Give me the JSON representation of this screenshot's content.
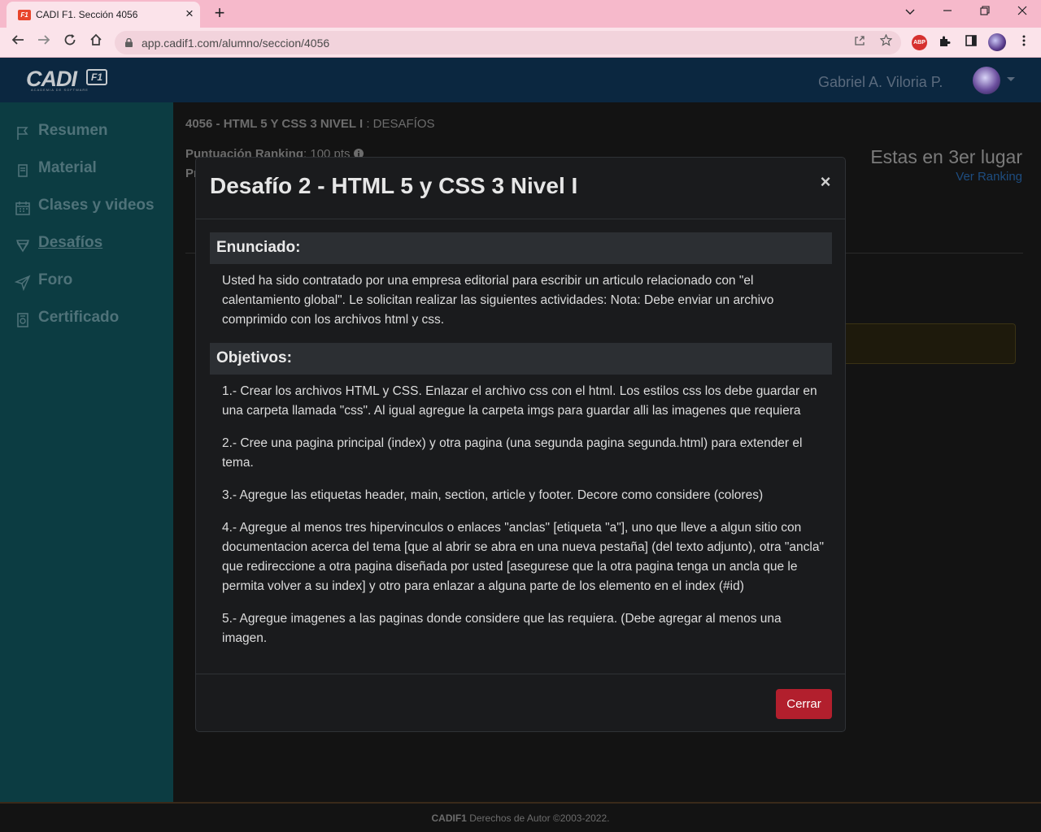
{
  "browser": {
    "tab_title": "CADI F1. Sección 4056",
    "tab_close": "×",
    "new_tab": "+",
    "favicon_text": "F1",
    "url": "app.cadif1.com/alumno/seccion/4056",
    "extensions": {
      "abp": "ABP"
    }
  },
  "header": {
    "logo_text": "CADI",
    "logo_badge": "F1",
    "logo_sub": "ACADEMIA DE SOFTWARE",
    "user_name": "Gabriel A. Viloria P."
  },
  "sidebar": {
    "items": [
      {
        "label": "Resumen",
        "icon": "flag-icon"
      },
      {
        "label": "Material",
        "icon": "book-icon"
      },
      {
        "label": "Clases y videos",
        "icon": "calendar-icon"
      },
      {
        "label": "Desafíos",
        "icon": "trophy-icon",
        "active": true
      },
      {
        "label": "Foro",
        "icon": "paper-plane-icon"
      },
      {
        "label": "Certificado",
        "icon": "certificate-icon"
      }
    ]
  },
  "main": {
    "course_code": "4056 - HTML 5 Y CSS 3 NIVEL I",
    "course_section": " : DESAFÍOS",
    "ranking_label": "Puntuación Ranking",
    "ranking_value": ": 100 pts",
    "cut_text": "Pr",
    "lugar": "Estas en 3er lugar",
    "ver_ranking": "Ver Ranking"
  },
  "modal": {
    "title": "Desafío 2 - HTML 5 y CSS 3 Nivel I",
    "close": "×",
    "enunciado_title": "Enunciado:",
    "enunciado_text": "Usted ha sido contratado por una empresa editorial para escribir un articulo relacionado con \"el calentamiento global\". Le solicitan realizar las siguientes actividades: Nota: Debe enviar un archivo comprimido con los archivos html y css.",
    "objetivos_title": "Objetivos:",
    "objetivos": [
      "1.- Crear los archivos HTML y CSS. Enlazar el archivo css con el html. Los estilos css los debe guardar en una carpeta llamada \"css\". Al igual agregue la carpeta imgs para guardar alli las imagenes que requiera",
      "2.- Cree una pagina principal (index) y otra pagina (una segunda pagina segunda.html) para extender el tema.",
      "3.- Agregue las etiquetas header, main, section, article y footer. Decore como considere (colores)",
      "4.- Agregue al menos tres hipervinculos o enlaces \"anclas\" [etiqueta \"a\"], uno que lleve a algun sitio con documentacion acerca del tema [que al abrir se abra en una nueva pestaña] (del texto adjunto), otra \"ancla\" que redireccione a otra pagina diseñada por usted [asegurese que la otra pagina tenga un ancla que le permita volver a su index] y otro para enlazar a alguna parte de los elemento en el index (#id)",
      "5.- Agregue imagenes a las paginas donde considere que las requiera. (Debe agregar al menos una imagen."
    ],
    "close_button": "Cerrar"
  },
  "footer": {
    "brand": "CADIF1",
    "text": " Derechos de Autor ©2003-2022."
  },
  "colors": {
    "chrome_pink": "#f6b9cb",
    "header_navy": "#0b2740",
    "sidebar_teal": "#0c3c42",
    "danger": "#b21f2d",
    "link": "#1e4d80"
  }
}
